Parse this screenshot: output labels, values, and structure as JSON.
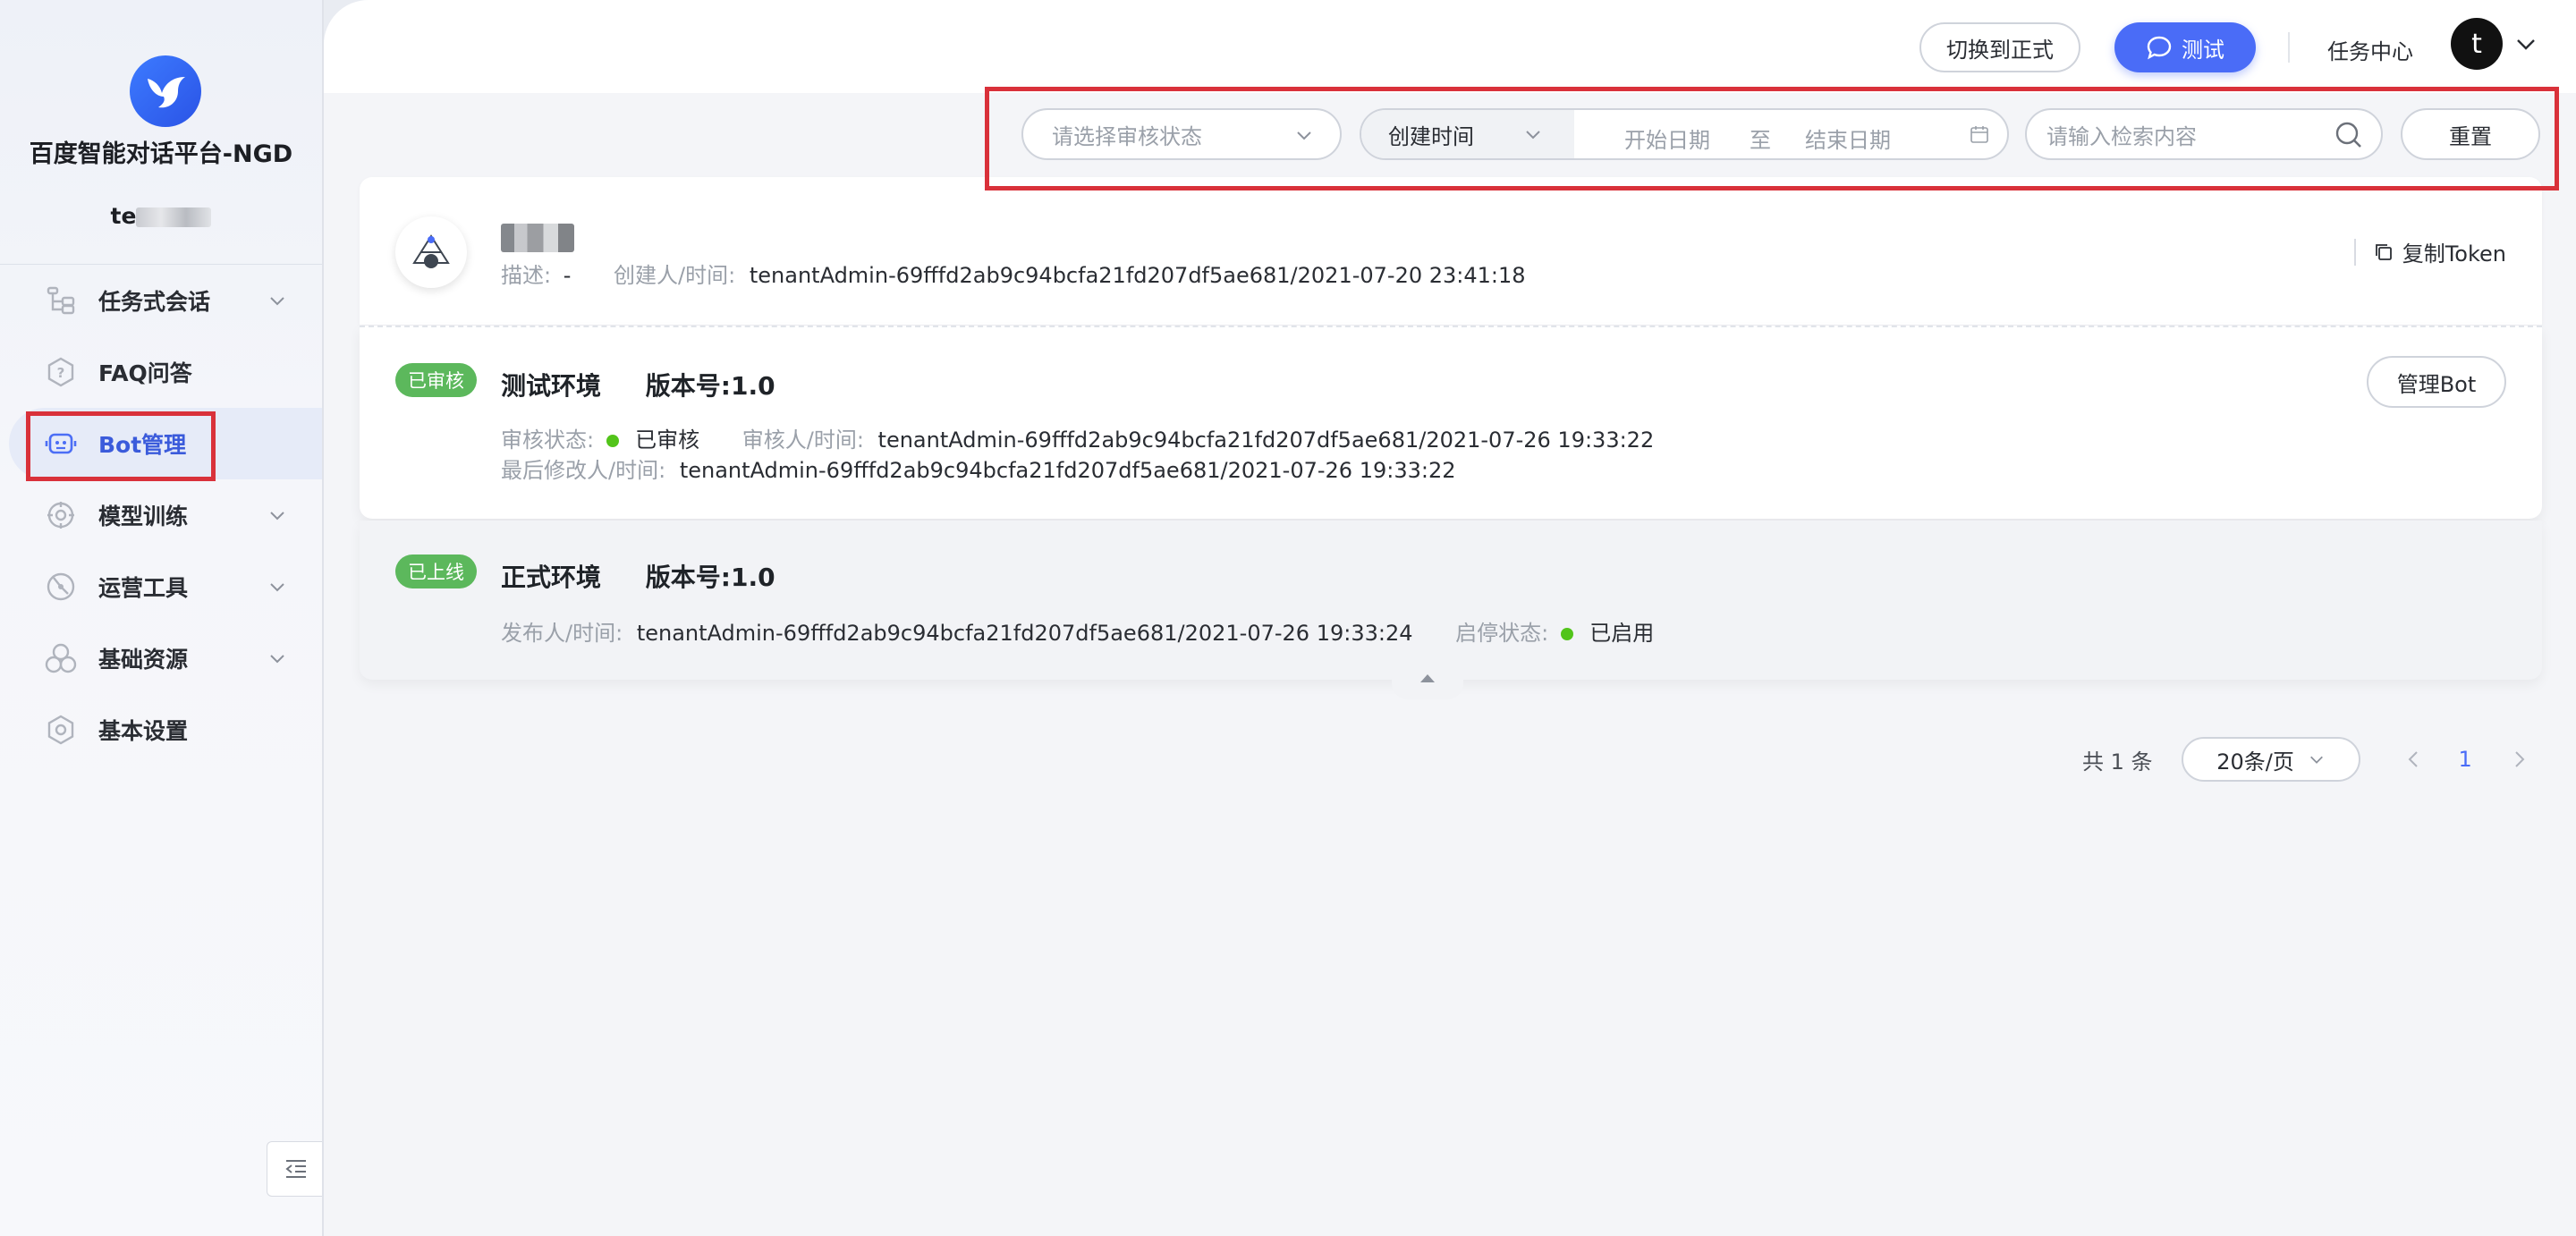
{
  "sidebar": {
    "brand": "百度智能对话平台-NGD",
    "tenant_visible": "te",
    "nav": [
      {
        "label": "任务式会话",
        "icon": "task-dialog-icon",
        "expandable": true
      },
      {
        "label": "FAQ问答",
        "icon": "faq-icon",
        "expandable": false
      },
      {
        "label": "Bot管理",
        "icon": "bot-icon",
        "expandable": false,
        "active": true
      },
      {
        "label": "模型训练",
        "icon": "model-training-icon",
        "expandable": true
      },
      {
        "label": "运营工具",
        "icon": "operation-tools-icon",
        "expandable": true
      },
      {
        "label": "基础资源",
        "icon": "basic-resources-icon",
        "expandable": true
      },
      {
        "label": "基本设置",
        "icon": "settings-icon",
        "expandable": false
      }
    ]
  },
  "topbar": {
    "switch_label": "切换到正式",
    "test_label": "测试",
    "task_center": "任务中心",
    "avatar_letter": "t"
  },
  "filters": {
    "review_status_placeholder": "请选择审核状态",
    "time_type": "创建时间",
    "start_date": "开始日期",
    "to": "至",
    "end_date": "结束日期",
    "search_placeholder": "请输入检索内容",
    "reset": "重置"
  },
  "bot": {
    "desc_label": "描述:",
    "desc_value": "-",
    "creator_label": "创建人/时间:",
    "creator_value": "tenantAdmin-69fffd2ab9c94bcfa21fd207df5ae681/2021-07-20 23:41:18",
    "copy_token": "复制Token",
    "test_env": {
      "badge": "已审核",
      "title": "测试环境",
      "version_label": "版本号:",
      "version": "1.0",
      "review_status_label": "审核状态:",
      "review_status": "已审核",
      "reviewer_label": "审核人/时间:",
      "reviewer_value": "tenantAdmin-69fffd2ab9c94bcfa21fd207df5ae681/2021-07-26 19:33:22",
      "modifier_label": "最后修改人/时间:",
      "modifier_value": "tenantAdmin-69fffd2ab9c94bcfa21fd207df5ae681/2021-07-26 19:33:22",
      "manage_btn": "管理Bot"
    },
    "prod_env": {
      "badge": "已上线",
      "title": "正式环境",
      "version_label": "版本号:",
      "version": "1.0",
      "publisher_label": "发布人/时间:",
      "publisher_value": "tenantAdmin-69fffd2ab9c94bcfa21fd207df5ae681/2021-07-26 19:33:24",
      "status_label": "启停状态:",
      "status": "已启用"
    }
  },
  "pagination": {
    "total": "共 1 条",
    "page_size": "20条/页",
    "current_page": "1"
  },
  "colors": {
    "accent": "#4a6cf7",
    "success": "#5cb85c",
    "highlight_border": "#d9313a"
  }
}
